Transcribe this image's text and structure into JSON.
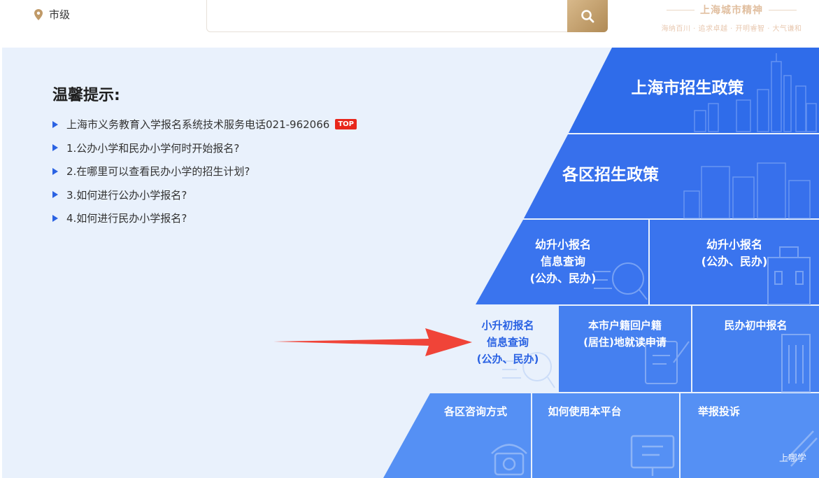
{
  "header": {
    "location": "市级",
    "search_placeholder": "",
    "slogan_title": "上海城市精神",
    "slogan_sub": "海纳百川 · 追求卓越 · 开明睿智 · 大气谦和"
  },
  "tips": {
    "title": "温馨提示:",
    "items": [
      {
        "text": "上海市义务教育入学报名系统技术服务电话021-962066",
        "badge": "TOP"
      },
      {
        "text": "1.公办小学和民办小学何时开始报名?"
      },
      {
        "text": "2.在哪里可以查看民办小学的招生计划?"
      },
      {
        "text": "3.如何进行公办小学报名?"
      },
      {
        "text": "4.如何进行民办小学报名?"
      }
    ]
  },
  "tiles": {
    "city_policy": "上海市招生政策",
    "district_policy": "各区招生政策",
    "k2p_query_l1": "幼升小报名",
    "k2p_query_l2": "信息查询",
    "k2p_query_l3": "(公办、民办)",
    "k2p_signup_l1": "幼升小报名",
    "k2p_signup_l2": "(公办、民办)",
    "p2m_query_l1": "小升初报名",
    "p2m_query_l2": "信息查询",
    "p2m_query_l3": "(公办、民办)",
    "hukou_l1": "本市户籍回户籍",
    "hukou_l2": "(居住)地就读申请",
    "private_middle": "民办初中报名",
    "consult": "各区咨询方式",
    "howto": "如何使用本平台",
    "report": "举报投诉"
  },
  "watermark": "上哪学",
  "colors": {
    "accent_blue": "#2a62e3",
    "tile_blue": "#3d79ee",
    "tile_light": "#5b93f4",
    "highlight_bg": "#e9f1fc",
    "arrow_red": "#f04438",
    "gold": "#c09a68"
  }
}
